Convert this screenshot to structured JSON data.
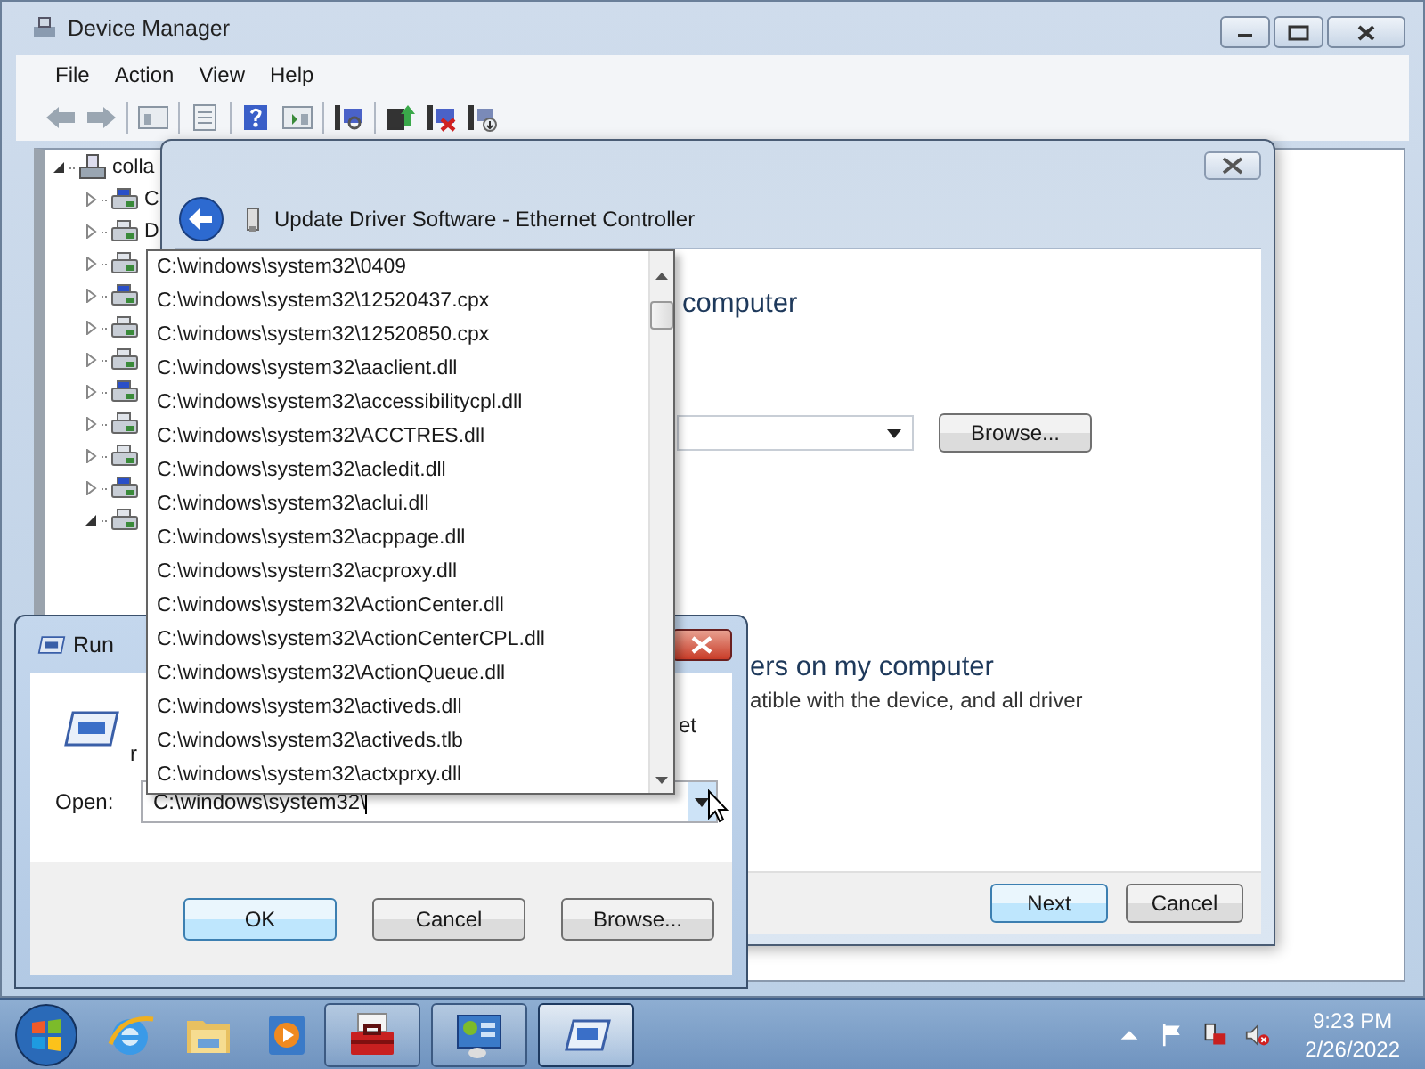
{
  "device_manager": {
    "title": "Device Manager",
    "menu": [
      "File",
      "Action",
      "View",
      "Help"
    ],
    "tree": [
      {
        "label": "colla",
        "expanded": true,
        "children": [
          {
            "label": "C",
            "expanded": false
          },
          {
            "label": "D",
            "expanded": false
          },
          {
            "expanded": false
          },
          {
            "expanded": false
          },
          {
            "expanded": false
          },
          {
            "expanded": false
          },
          {
            "expanded": false
          },
          {
            "expanded": false
          },
          {
            "expanded": false
          },
          {
            "expanded": false
          },
          {
            "expanded": true
          }
        ]
      }
    ]
  },
  "update_driver": {
    "title": "Update Driver Software - Ethernet Controller",
    "heading": "computer",
    "browse_button": "Browse...",
    "option_heading": "ers on my computer",
    "option_text": "atible with the device, and all driver",
    "buttons": [
      {
        "label": "Next",
        "default": true
      },
      {
        "label": "Cancel",
        "default": false
      }
    ]
  },
  "run": {
    "title": "Run",
    "text_fragments": [
      "r",
      "et"
    ],
    "open_label": "Open:",
    "value": "C:\\windows\\system32\\",
    "buttons": [
      {
        "label": "OK",
        "default": true
      },
      {
        "label": "Cancel",
        "default": false
      },
      {
        "label": "Browse...",
        "default": false
      }
    ]
  },
  "autocomplete": {
    "items": [
      "C:\\windows\\system32\\0409",
      "C:\\windows\\system32\\12520437.cpx",
      "C:\\windows\\system32\\12520850.cpx",
      "C:\\windows\\system32\\aaclient.dll",
      "C:\\windows\\system32\\accessibilitycpl.dll",
      "C:\\windows\\system32\\ACCTRES.dll",
      "C:\\windows\\system32\\acledit.dll",
      "C:\\windows\\system32\\aclui.dll",
      "C:\\windows\\system32\\acppage.dll",
      "C:\\windows\\system32\\acproxy.dll",
      "C:\\windows\\system32\\ActionCenter.dll",
      "C:\\windows\\system32\\ActionCenterCPL.dll",
      "C:\\windows\\system32\\ActionQueue.dll",
      "C:\\windows\\system32\\activeds.dll",
      "C:\\windows\\system32\\activeds.tlb",
      "C:\\windows\\system32\\actxprxy.dll"
    ]
  },
  "taskbar": {
    "apps": [
      {
        "kind": "toolbox",
        "active": false
      },
      {
        "kind": "control-panel",
        "active": false
      },
      {
        "kind": "run",
        "active": true
      }
    ],
    "time": "9:23 PM",
    "date": "2/26/2022"
  }
}
